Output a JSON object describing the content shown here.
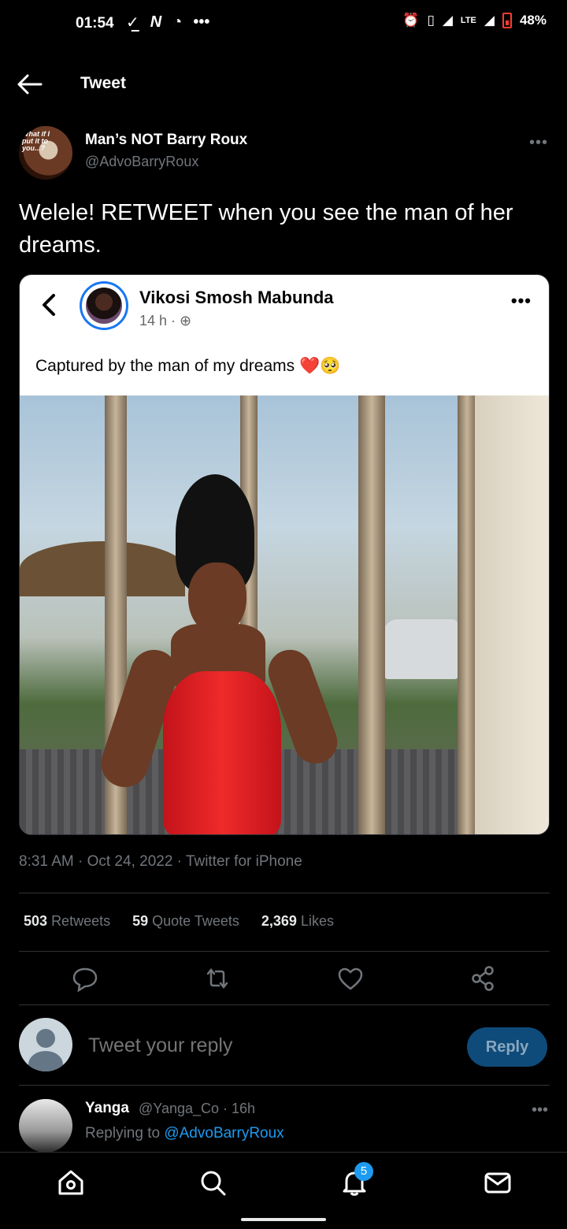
{
  "status_bar": {
    "time": "01:54",
    "left_icons": [
      "check-icon",
      "n-icon",
      "chat-icon",
      "more-dots"
    ],
    "network": "LTE",
    "battery": "48%"
  },
  "header": {
    "title": "Tweet"
  },
  "tweet": {
    "author_name": "Man’s NOT Barry Roux",
    "author_handle": "@AdvoBarryRoux",
    "avatar_text": "What if I put it to you...?",
    "text": "Welele! RETWEET when you see the man of her dreams.",
    "timestamp": "8:31 AM · Oct 24, 2022 · Twitter for iPhone",
    "retweets": "503",
    "retweets_label": "Retweets",
    "quotes": "59",
    "quotes_label": "Quote Tweets",
    "likes": "2,369",
    "likes_label": "Likes"
  },
  "embedded_post": {
    "name": "Vikosi Smosh Mabunda",
    "time": "14 h ·",
    "caption": "Captured by the man of my dreams",
    "caption_emoji": "❤️🥺",
    "more": "•••"
  },
  "reply_box": {
    "placeholder": "Tweet your reply",
    "button": "Reply"
  },
  "reply": {
    "name": "Yanga",
    "handle_time": "@Yanga_Co · 16h",
    "replying_prefix": "Replying to",
    "replying_to": "@AdvoBarryRoux"
  },
  "bottom_nav": {
    "notifications_badge": "5"
  },
  "colors": {
    "background": "#000000",
    "accent": "#1d9bf0",
    "muted": "#71767b",
    "reply_button": "#0e4b7a"
  }
}
